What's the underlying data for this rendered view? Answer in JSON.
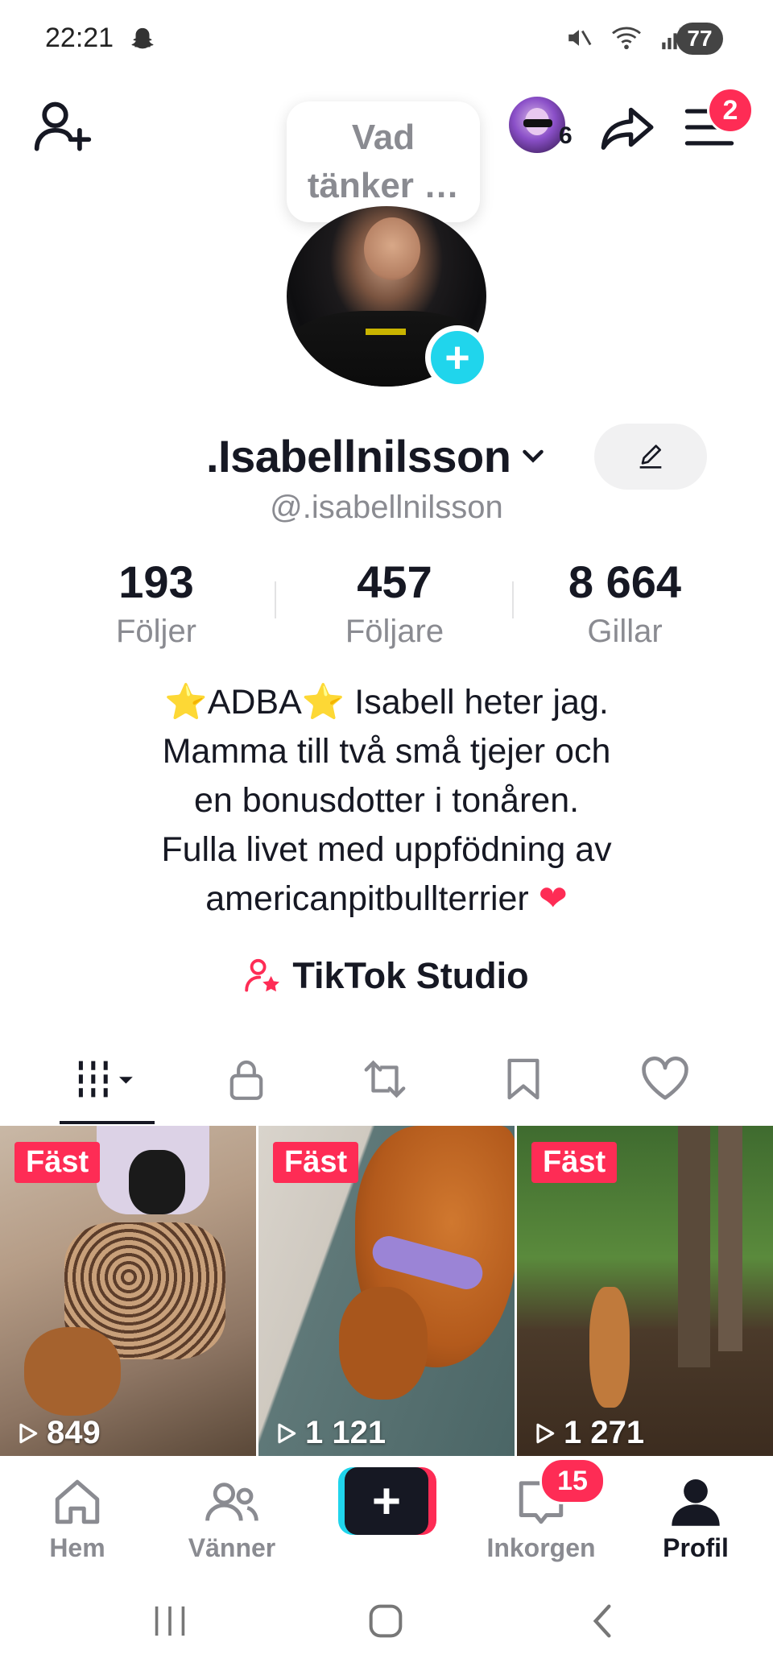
{
  "status_bar": {
    "time": "22:21",
    "battery": "77"
  },
  "header": {
    "note_bubble": "Vad tänker …",
    "avatar_count": "6",
    "menu_badge": "2"
  },
  "profile": {
    "display_name": ".Isabellnilsson",
    "username": "@.isabellnilsson",
    "stats": [
      {
        "value": "193",
        "label": "Följer"
      },
      {
        "value": "457",
        "label": "Följare"
      },
      {
        "value": "8 664",
        "label": "Gillar"
      }
    ],
    "bio": {
      "line1_pre": "⭐",
      "line1_mid": "ADBA",
      "line1_star2": "⭐",
      "line1_post": " Isabell heter jag.",
      "line2": "Mamma till två små tjejer och",
      "line3": "en bonusdotter i tonåren.",
      "line4": "Fulla livet med uppfödning av",
      "line5_text": "americanpitbullterrier ",
      "line5_heart": "❤"
    },
    "studio_label": "TikTok Studio"
  },
  "tabs": [
    {
      "icon": "grid-videos-icon",
      "active": true
    },
    {
      "icon": "lock-icon",
      "active": false
    },
    {
      "icon": "repost-icon",
      "active": false
    },
    {
      "icon": "bookmark-icon",
      "active": false
    },
    {
      "icon": "heart-icon",
      "active": false
    }
  ],
  "videos": [
    {
      "pinned_label": "Fäst",
      "views": "849"
    },
    {
      "pinned_label": "Fäst",
      "views": "1 121"
    },
    {
      "pinned_label": "Fäst",
      "views": "1 271"
    }
  ],
  "bottom_nav": {
    "home": "Hem",
    "friends": "Vänner",
    "inbox": "Inkorgen",
    "inbox_badge": "15",
    "profile": "Profil"
  },
  "colors": {
    "accent_red": "#fe2c55",
    "accent_cyan": "#20d5ec",
    "text": "#161823",
    "muted": "#8a8b91"
  }
}
